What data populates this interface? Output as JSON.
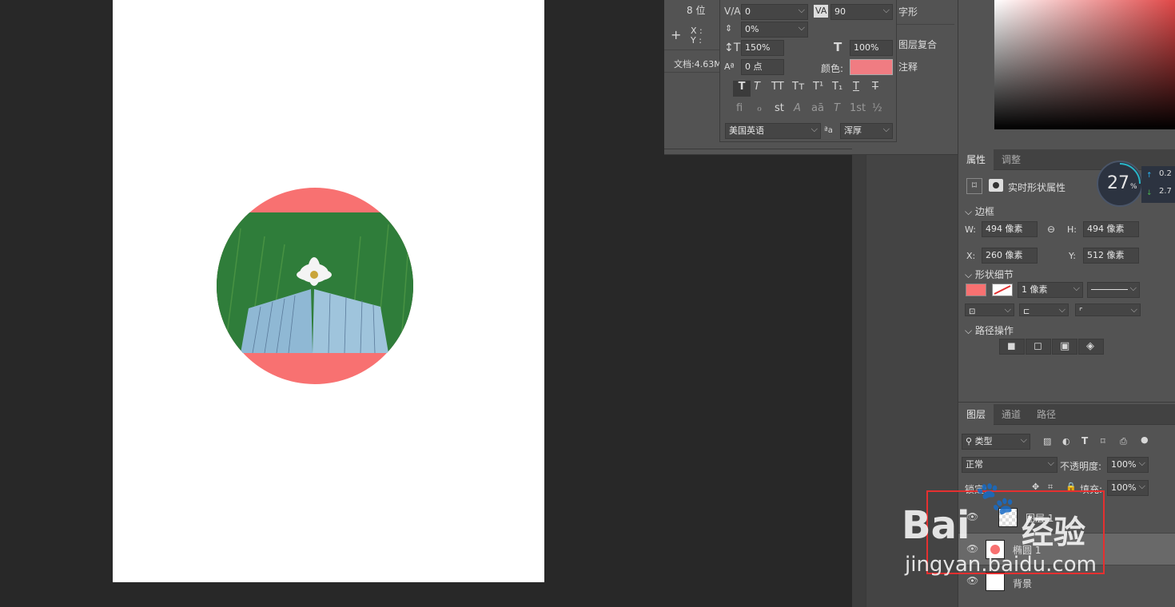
{
  "info_panel": {
    "bit_depth": "8 位",
    "x_label": "X :",
    "y_label": "Y :",
    "doc_info": "文档:4.63M"
  },
  "character_panel": {
    "tracking": "0",
    "kerning": "90",
    "vertical_scale_pct": "0%",
    "leading": "150%",
    "horizontal_scale": "100%",
    "baseline_shift": "0 点",
    "color_label": "颜色:",
    "color": "#f07c82",
    "language": "美国英语",
    "antialias": "浑厚",
    "style_buttons": [
      "T",
      "T",
      "TT",
      "Tт",
      "T¹",
      "T₁",
      "T",
      "T"
    ],
    "opentype_buttons": [
      "fi",
      "ℴ",
      "st",
      "A",
      "aā",
      "T",
      "1st",
      "½"
    ]
  },
  "side_list": {
    "items": [
      "字形",
      "图层复合",
      "注释"
    ]
  },
  "properties": {
    "tabs": [
      "属性",
      "调整"
    ],
    "shape_title": "实时形状属性",
    "bounds_section": "边框",
    "w_label": "W:",
    "w_value": "494 像素",
    "h_label": "H:",
    "h_value": "494 像素",
    "x_label": "X:",
    "x_value": "260 像素",
    "y_label": "Y:",
    "y_value": "512 像素",
    "shape_details_section": "形状细节",
    "fill_color": "#f87171",
    "stroke_width": "1 像素",
    "path_ops_section": "路径操作"
  },
  "gauge": {
    "value": "27",
    "unit": "%",
    "up": "0.2",
    "down": "2.7"
  },
  "layers_panel": {
    "tabs": [
      "图层",
      "通道",
      "路径"
    ],
    "filter_label": "类型",
    "blend_mode": "正常",
    "opacity_label": "不透明度:",
    "opacity": "100%",
    "lock_label": "锁定:",
    "fill_label": "填充:",
    "fill": "100%",
    "layers": [
      {
        "name": "图层 1"
      },
      {
        "name": "椭圆 1"
      },
      {
        "name": "背景"
      }
    ]
  },
  "watermark": {
    "brand": "Bai",
    "brand_suffix": "经验",
    "url": "jingyan.baidu.com"
  }
}
